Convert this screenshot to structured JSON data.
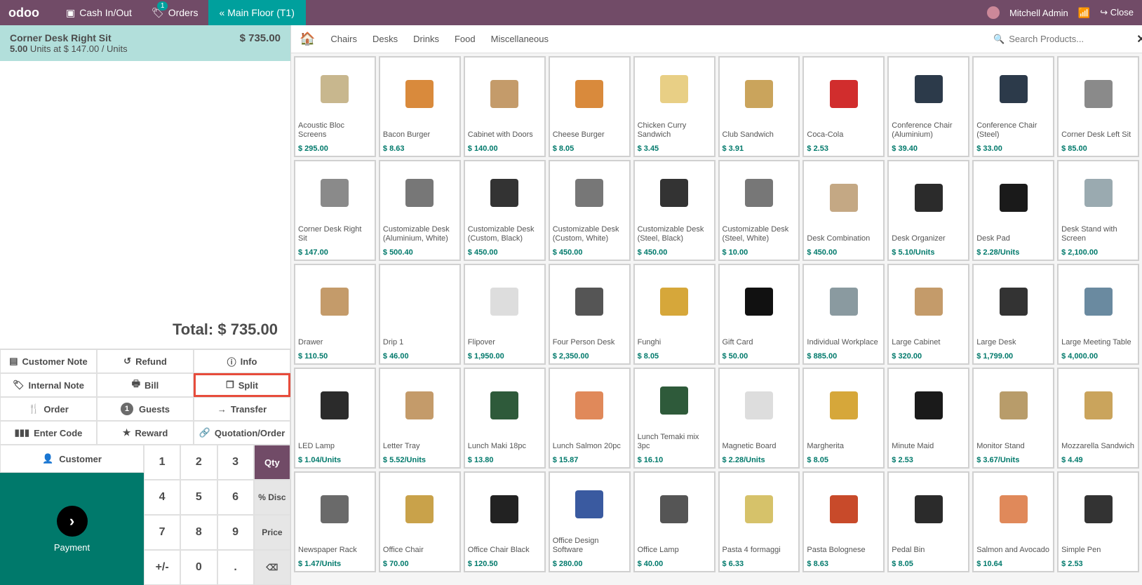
{
  "brand": "odoo",
  "topbar": {
    "cash": "Cash In/Out",
    "orders": "Orders",
    "orders_badge": "1",
    "main": "Main Floor  (T1)",
    "user": "Mitchell Admin",
    "close": "Close"
  },
  "order": {
    "line_name": "Corner Desk Right Sit",
    "line_sub_qty": "5.00",
    "line_sub_rest": " Units at $ 147.00 / Units",
    "line_price": "$ 735.00",
    "total_label": "Total: ",
    "total_value": "$ 735.00"
  },
  "actions": {
    "customer_note": "Customer Note",
    "refund": "Refund",
    "info": "Info",
    "internal_note": "Internal Note",
    "bill": "Bill",
    "split": "Split",
    "order": "Order",
    "guests_count": "1",
    "guests": "Guests",
    "transfer": "Transfer",
    "enter_code": "Enter Code",
    "reward": "Reward",
    "quotation": "Quotation/Order"
  },
  "bottom": {
    "customer": "Customer",
    "payment": "Payment"
  },
  "keypad": {
    "k1": "1",
    "k2": "2",
    "k3": "3",
    "qty": "Qty",
    "k4": "4",
    "k5": "5",
    "k6": "6",
    "disc": "% Disc",
    "k7": "7",
    "k8": "8",
    "k9": "9",
    "price": "Price",
    "pm": "+/-",
    "k0": "0",
    "dot": ".",
    "del": "⌫"
  },
  "categories": [
    "Chairs",
    "Desks",
    "Drinks",
    "Food",
    "Miscellaneous"
  ],
  "search_placeholder": "Search Products...",
  "products": [
    {
      "name": "Acoustic Bloc Screens",
      "price": "$ 295.00",
      "c": "#c8b78e"
    },
    {
      "name": "Bacon Burger",
      "price": "$ 8.63",
      "c": "#d98a3c"
    },
    {
      "name": "Cabinet with Doors",
      "price": "$ 140.00",
      "c": "#c49b6a"
    },
    {
      "name": "Cheese Burger",
      "price": "$ 8.05",
      "c": "#d98a3c"
    },
    {
      "name": "Chicken Curry Sandwich",
      "price": "$ 3.45",
      "c": "#e8cf85"
    },
    {
      "name": "Club Sandwich",
      "price": "$ 3.91",
      "c": "#caa45c"
    },
    {
      "name": "Coca-Cola",
      "price": "$ 2.53",
      "c": "#d12d2d"
    },
    {
      "name": "Conference Chair (Aluminium)",
      "price": "$ 39.40",
      "c": "#2c3a4a"
    },
    {
      "name": "Conference Chair (Steel)",
      "price": "$ 33.00",
      "c": "#2c3a4a"
    },
    {
      "name": "Corner Desk Left Sit",
      "price": "$ 85.00",
      "c": "#8a8a8a"
    },
    {
      "name": "Corner Desk Right Sit",
      "price": "$ 147.00",
      "c": "#8a8a8a"
    },
    {
      "name": "Customizable Desk (Aluminium, White)",
      "price": "$ 500.40",
      "c": "#777"
    },
    {
      "name": "Customizable Desk (Custom, Black)",
      "price": "$ 450.00",
      "c": "#333"
    },
    {
      "name": "Customizable Desk (Custom, White)",
      "price": "$ 450.00",
      "c": "#777"
    },
    {
      "name": "Customizable Desk (Steel, Black)",
      "price": "$ 450.00",
      "c": "#333"
    },
    {
      "name": "Customizable Desk (Steel, White)",
      "price": "$ 10.00",
      "c": "#777"
    },
    {
      "name": "Desk Combination",
      "price": "$ 450.00",
      "c": "#c4a884"
    },
    {
      "name": "Desk Organizer",
      "price": "$ 5.10/Units",
      "c": "#2b2b2b"
    },
    {
      "name": "Desk Pad",
      "price": "$ 2.28/Units",
      "c": "#1a1a1a"
    },
    {
      "name": "Desk Stand with Screen",
      "price": "$ 2,100.00",
      "c": "#9aaab0"
    },
    {
      "name": "Drawer",
      "price": "$ 110.50",
      "c": "#c49b6a"
    },
    {
      "name": "Drip 1",
      "price": "$ 46.00",
      "c": "#ffffff"
    },
    {
      "name": "Flipover",
      "price": "$ 1,950.00",
      "c": "#ddd"
    },
    {
      "name": "Four Person Desk",
      "price": "$ 2,350.00",
      "c": "#555"
    },
    {
      "name": "Funghi",
      "price": "$ 8.05",
      "c": "#d6a73a"
    },
    {
      "name": "Gift Card",
      "price": "$ 50.00",
      "c": "#111"
    },
    {
      "name": "Individual Workplace",
      "price": "$ 885.00",
      "c": "#8a9aa0"
    },
    {
      "name": "Large Cabinet",
      "price": "$ 320.00",
      "c": "#c49b6a"
    },
    {
      "name": "Large Desk",
      "price": "$ 1,799.00",
      "c": "#333"
    },
    {
      "name": "Large Meeting Table",
      "price": "$ 4,000.00",
      "c": "#6a8aa0"
    },
    {
      "name": "LED Lamp",
      "price": "$ 1.04/Units",
      "c": "#2b2b2b"
    },
    {
      "name": "Letter Tray",
      "price": "$ 5.52/Units",
      "c": "#c49b6a"
    },
    {
      "name": "Lunch Maki 18pc",
      "price": "$ 13.80",
      "c": "#2e5a3a"
    },
    {
      "name": "Lunch Salmon 20pc",
      "price": "$ 15.87",
      "c": "#e0895a"
    },
    {
      "name": "Lunch Temaki mix 3pc",
      "price": "$ 16.10",
      "c": "#2e5a3a"
    },
    {
      "name": "Magnetic Board",
      "price": "$ 2.28/Units",
      "c": "#ddd"
    },
    {
      "name": "Margherita",
      "price": "$ 8.05",
      "c": "#d6a73a"
    },
    {
      "name": "Minute Maid",
      "price": "$ 2.53",
      "c": "#1a1a1a"
    },
    {
      "name": "Monitor Stand",
      "price": "$ 3.67/Units",
      "c": "#b89c6a"
    },
    {
      "name": "Mozzarella Sandwich",
      "price": "$ 4.49",
      "c": "#caa45c"
    },
    {
      "name": "Newspaper Rack",
      "price": "$ 1.47/Units",
      "c": "#6a6a6a"
    },
    {
      "name": "Office Chair",
      "price": "$ 70.00",
      "c": "#c9a24a"
    },
    {
      "name": "Office Chair Black",
      "price": "$ 120.50",
      "c": "#222"
    },
    {
      "name": "Office Design Software",
      "price": "$ 280.00",
      "c": "#3a5aa0"
    },
    {
      "name": "Office Lamp",
      "price": "$ 40.00",
      "c": "#555"
    },
    {
      "name": "Pasta 4 formaggi",
      "price": "$ 6.33",
      "c": "#d6c26a"
    },
    {
      "name": "Pasta Bolognese",
      "price": "$ 8.63",
      "c": "#c84a2a"
    },
    {
      "name": "Pedal Bin",
      "price": "$ 8.05",
      "c": "#2b2b2b"
    },
    {
      "name": "Salmon and Avocado",
      "price": "$ 10.64",
      "c": "#e0895a"
    },
    {
      "name": "Simple Pen",
      "price": "$ 2.53",
      "c": "#333"
    }
  ]
}
